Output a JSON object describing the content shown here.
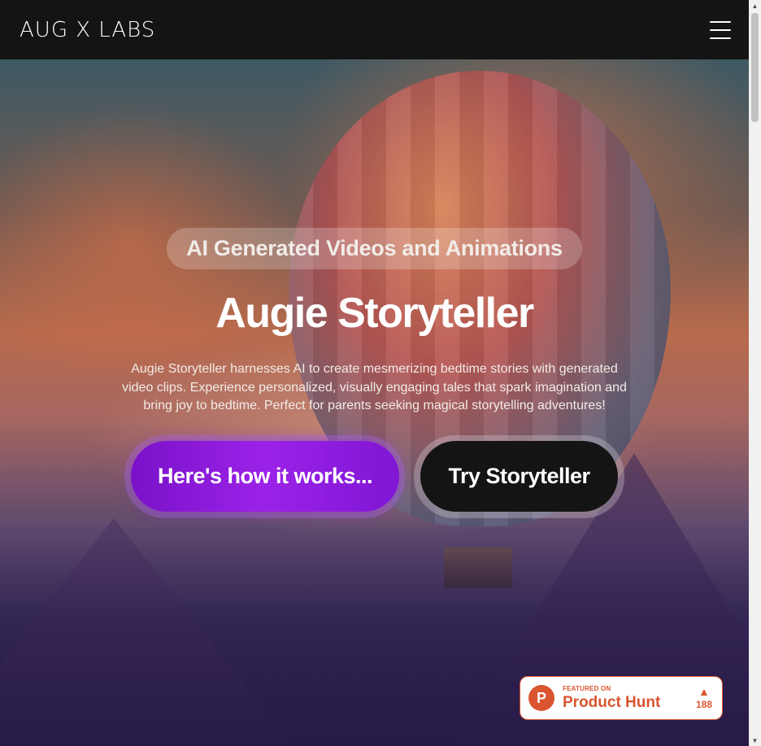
{
  "header": {
    "logo": "AUG X LABS",
    "menu_icon": "hamburger-menu-icon"
  },
  "hero": {
    "tagline": "AI Generated Videos and Animations",
    "title": "Augie Storyteller",
    "description": "Augie Storyteller harnesses AI to create mesmerizing bedtime stories with generated video clips. Experience personalized, visually engaging tales that spark imagination and bring joy to bedtime. Perfect for parents seeking magical storytelling adventures!",
    "buttons": {
      "how_it_works": "Here's how it works...",
      "try": "Try Storyteller"
    },
    "background": "hot-air-balloon-sunset-illustration"
  },
  "product_hunt": {
    "logo_letter": "P",
    "featured_label": "FEATURED ON",
    "name": "Product Hunt",
    "vote_arrow": "▲",
    "votes": "188"
  },
  "scrollbar": {
    "up_arrow": "▲",
    "down_arrow": "▼"
  },
  "colors": {
    "header_bg": "#141414",
    "button_purple": "#9b22e8",
    "button_dark": "#141414",
    "product_hunt": "#da552f"
  }
}
